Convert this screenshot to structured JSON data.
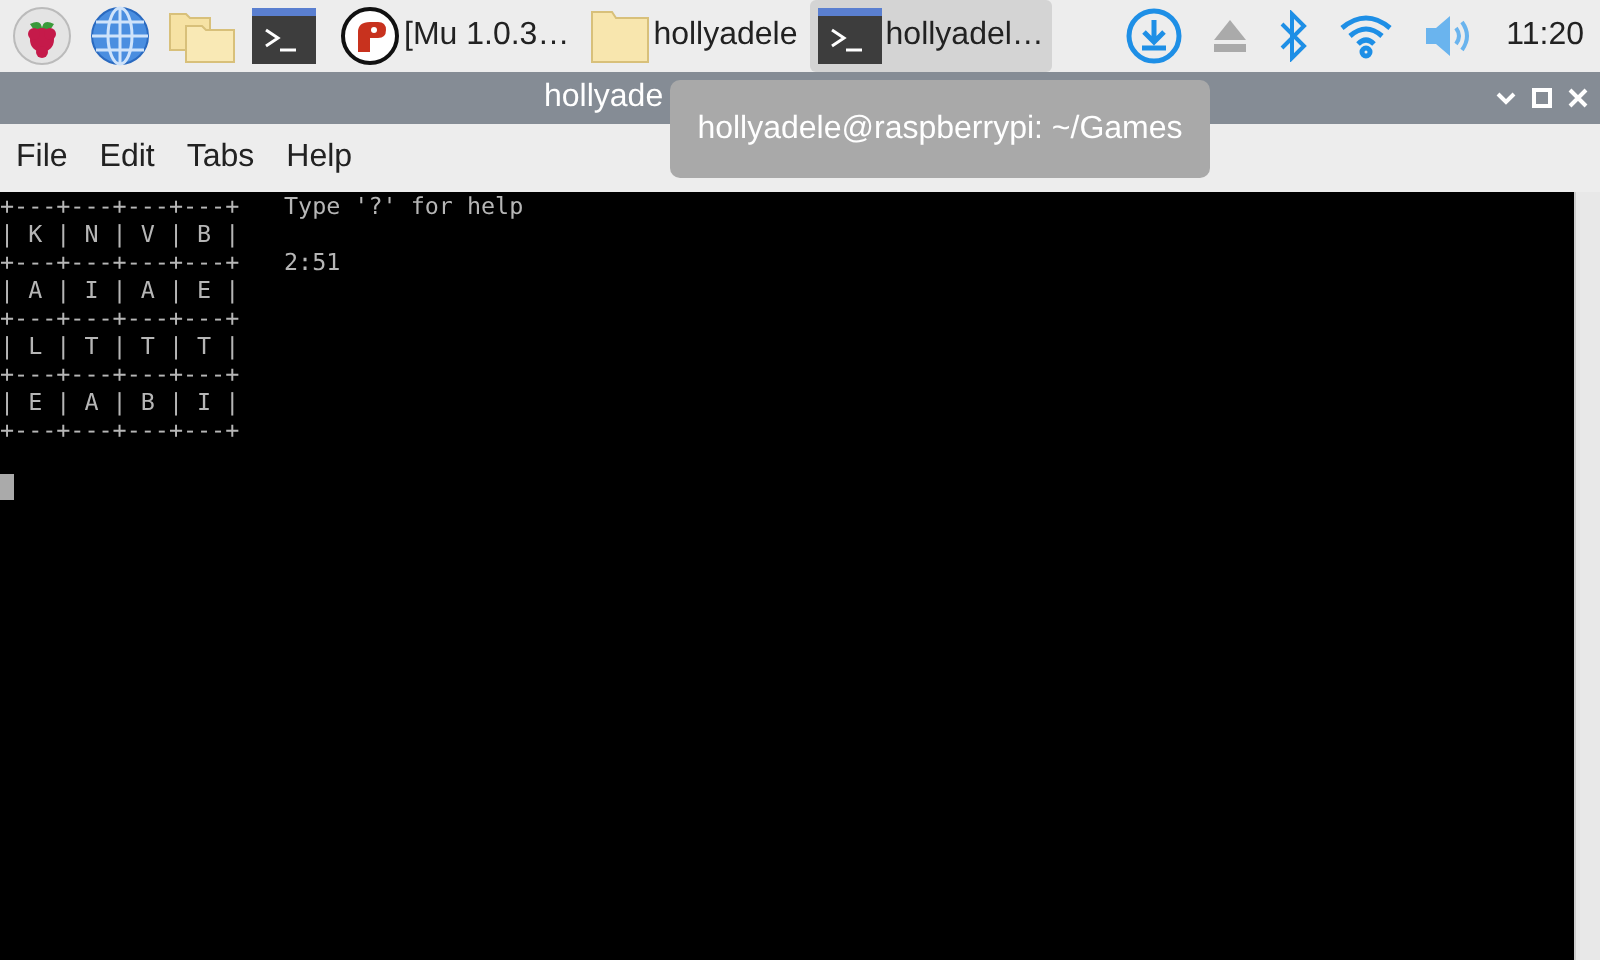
{
  "taskbar": {
    "launchers": [
      {
        "kind": "menu"
      },
      {
        "kind": "browser"
      },
      {
        "kind": "files"
      },
      {
        "kind": "terminal"
      }
    ],
    "tasks": [
      {
        "kind": "mu",
        "label": "[Mu 1.0.3…",
        "selected": false
      },
      {
        "kind": "folder",
        "label": "hollyadele",
        "selected": false
      },
      {
        "kind": "terminal",
        "label": "hollyadel…",
        "selected": true
      }
    ],
    "tray": [
      {
        "kind": "download"
      },
      {
        "kind": "eject"
      },
      {
        "kind": "bluetooth"
      },
      {
        "kind": "wifi"
      },
      {
        "kind": "volume"
      }
    ],
    "clock": "11:20"
  },
  "window": {
    "title": "hollyade",
    "tooltip": "hollyadele@raspberrypi: ~/Games",
    "menu": [
      "File",
      "Edit",
      "Tabs",
      "Help"
    ],
    "terminal": {
      "board": [
        "+---+---+---+---+",
        "| K | N | V | B |",
        "+---+---+---+---+",
        "| A | I | A | E |",
        "+---+---+---+---+",
        "| L | T | T | T |",
        "+---+---+---+---+",
        "| E | A | B | I |",
        "+---+---+---+---+"
      ],
      "help": "Type '?' for help",
      "timer": "2:51"
    }
  }
}
